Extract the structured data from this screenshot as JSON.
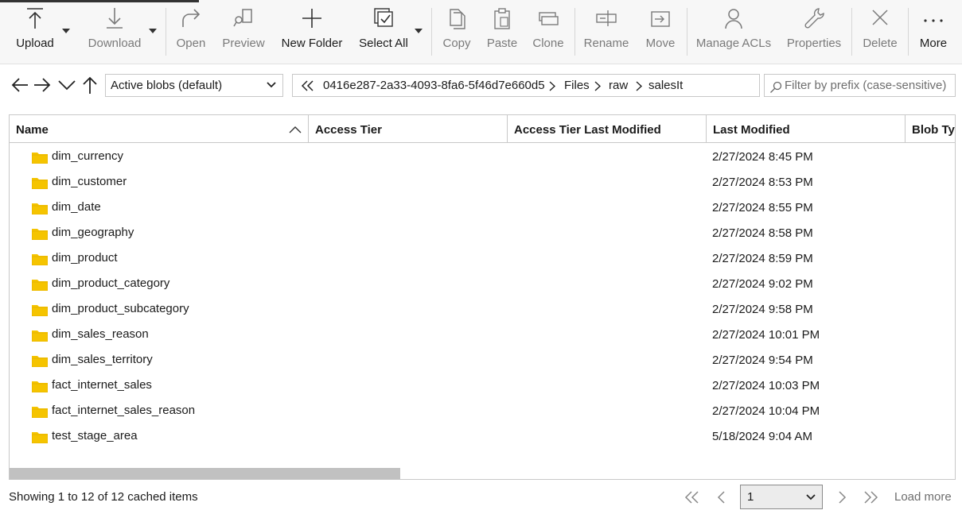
{
  "toolbar": {
    "upload": "Upload",
    "download": "Download",
    "open": "Open",
    "preview": "Preview",
    "new_folder": "New Folder",
    "select_all": "Select All",
    "copy": "Copy",
    "paste": "Paste",
    "clone": "Clone",
    "rename": "Rename",
    "move": "Move",
    "manage_acls": "Manage ACLs",
    "properties": "Properties",
    "delete": "Delete",
    "more": "More"
  },
  "nav": {
    "blob_filter": "Active blobs (default)",
    "breadcrumb": [
      "0416e287-2a33-4093-8fa6-5f46d7e660d5",
      "Files",
      "raw",
      "salesIt"
    ],
    "filter_placeholder": "Filter by prefix (case-sensitive)"
  },
  "table": {
    "columns": [
      "Name",
      "Access Tier",
      "Access Tier Last Modified",
      "Last Modified",
      "Blob Type"
    ],
    "rows": [
      {
        "name": "dim_currency",
        "modified": "2/27/2024 8:45 PM"
      },
      {
        "name": "dim_customer",
        "modified": "2/27/2024 8:53 PM"
      },
      {
        "name": "dim_date",
        "modified": "2/27/2024 8:55 PM"
      },
      {
        "name": "dim_geography",
        "modified": "2/27/2024 8:58 PM"
      },
      {
        "name": "dim_product",
        "modified": "2/27/2024 8:59 PM"
      },
      {
        "name": "dim_product_category",
        "modified": "2/27/2024 9:02 PM"
      },
      {
        "name": "dim_product_subcategory",
        "modified": "2/27/2024 9:58 PM"
      },
      {
        "name": "dim_sales_reason",
        "modified": "2/27/2024 10:01 PM"
      },
      {
        "name": "dim_sales_territory",
        "modified": "2/27/2024 9:54 PM"
      },
      {
        "name": "fact_internet_sales",
        "modified": "2/27/2024 10:03 PM"
      },
      {
        "name": "fact_internet_sales_reason",
        "modified": "2/27/2024 10:04 PM"
      },
      {
        "name": "test_stage_area",
        "modified": "5/18/2024 9:04 AM"
      }
    ]
  },
  "footer": {
    "status": "Showing 1 to 12 of 12 cached items",
    "page": "1",
    "load_more": "Load more"
  },
  "colors": {
    "folder": "#f5c400",
    "toolbar_bg": "#f7f7f7",
    "border": "#c8c8c8",
    "disabled_text": "#7a7a7a"
  }
}
